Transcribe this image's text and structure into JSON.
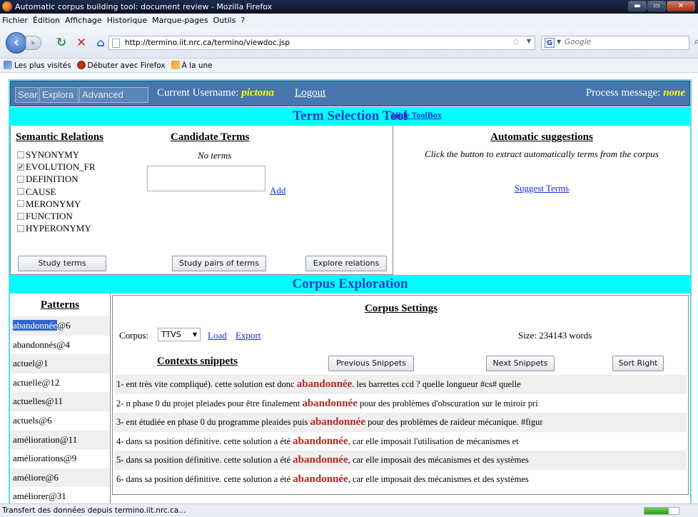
{
  "window": {
    "title": "Automatic corpus building tool: document review - Mozilla Firefox",
    "controls": [
      "minimize",
      "maximize",
      "close"
    ]
  },
  "menu": {
    "items": [
      "Fichier",
      "Édition",
      "Affichage",
      "Historique",
      "Marque-pages",
      "Outils",
      "?"
    ]
  },
  "nav": {
    "url": "http://termino.iit.nrc.ca/termino/viewdoc.jsp",
    "search_placeholder": "Google",
    "search_engine_letter": "G"
  },
  "bookmarks": {
    "items": [
      "Les plus visités",
      "Débuter avec Firefox",
      "À la une"
    ]
  },
  "topbar": {
    "tabs": [
      "Search",
      "Explora",
      "Advanced"
    ],
    "user_label": "Current Username:",
    "username": "pictona",
    "logout": "Logout",
    "process_label": "Process message:",
    "process_value": "none"
  },
  "term_tool": {
    "title": "Term Selection Tool",
    "hide_link": "Hide ToolBox",
    "semantic_heading": "Semantic Relations",
    "relations": [
      {
        "label": "SYNONYMY",
        "checked": false
      },
      {
        "label": "EVOLUTION_FR",
        "checked": true
      },
      {
        "label": "DEFINITION",
        "checked": false
      },
      {
        "label": "CAUSE",
        "checked": false
      },
      {
        "label": "MERONYMY",
        "checked": false
      },
      {
        "label": "FUNCTION",
        "checked": false
      },
      {
        "label": "HYPERONYMY",
        "checked": false
      }
    ],
    "candidate_heading": "Candidate Terms",
    "no_terms": "No terms",
    "add_link": "Add",
    "buttons": {
      "study": "Study terms",
      "pairs": "Study pairs of terms",
      "explore": "Explore relations"
    },
    "auto_heading": "Automatic suggestions",
    "auto_desc": "Click the button to extract automatically terms from the corpus",
    "suggest_link": "Suggest Terms"
  },
  "corpus": {
    "title": "Corpus Exploration",
    "patterns_heading": "Patterns",
    "patterns": [
      {
        "word": "abandonnée",
        "count": "@6",
        "selected": true
      },
      {
        "word": "abandonnés",
        "count": "@4"
      },
      {
        "word": "actuel",
        "count": "@1"
      },
      {
        "word": "actuelle",
        "count": "@12"
      },
      {
        "word": "actuelles",
        "count": "@11"
      },
      {
        "word": "actuels",
        "count": "@6"
      },
      {
        "word": "amélioration",
        "count": "@11"
      },
      {
        "word": "améliorations",
        "count": "@9"
      },
      {
        "word": "améliore",
        "count": "@6"
      },
      {
        "word": "améliorer",
        "count": "@31"
      }
    ],
    "settings_heading": "Corpus Settings",
    "corpus_label": "Corpus:",
    "corpus_value": "TTVS",
    "load_link": "Load",
    "export_link": "Export",
    "size": "Size: 234143 words",
    "contexts_heading": "Contexts snippets",
    "buttons": {
      "prev": "Previous Snippets",
      "next": "Next Snippets",
      "sort": "Sort Right"
    },
    "snippets": [
      {
        "pre": "1- ent très vite compliqué). cette solution est donc ",
        "kw": "abandonnée",
        "post": ". les barrettes ccd ? quelle longueur #cs# quelle"
      },
      {
        "pre": "2- n phase 0 du projet pleiades pour être finalement ",
        "kw": "abandonnée",
        "post": " pour des problèmes d'obscuration sur le miroir pri"
      },
      {
        "pre": "3- ent étudiée en phase 0 du programme pleaides puis ",
        "kw": "abandonnée",
        "post": " pour des problèmes de raideur mécanique. #figur"
      },
      {
        "pre": "4- dans sa position définitive. cette solution a été ",
        "kw": "abandonnée",
        "post": ", car elle imposait l'utilisation de mécanismes et"
      },
      {
        "pre": "5- dans sa position définitive. cette solution a été ",
        "kw": "abandonnée",
        "post": ", car elle imposait des mécanismes et des systèmes"
      },
      {
        "pre": "6- dans sa position définitive. cette solution a été ",
        "kw": "abandonnée",
        "post": ", car elle imposait des mécanismes et des systèmes"
      }
    ]
  },
  "status": {
    "text": "Transfert des données depuis termino.iit.nrc.ca...",
    "progress": 0.7
  }
}
